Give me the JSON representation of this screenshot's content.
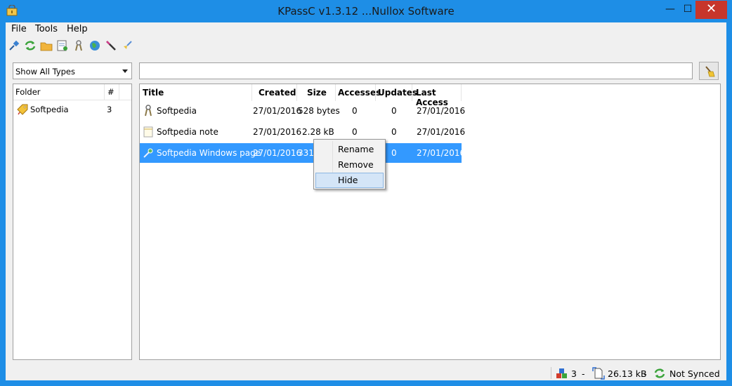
{
  "window": {
    "title": "KPassC v1.3.12 ...Nullox Software",
    "min_glyph": "—",
    "max_glyph": "☐",
    "close_glyph": "✕"
  },
  "menu": [
    "File",
    "Tools",
    "Help"
  ],
  "toolbar": {
    "icons": [
      "pin-icon",
      "sync-icon",
      "folder-icon",
      "note-icon",
      "key-icon",
      "globe-icon",
      "wand-icon",
      "broom-icon"
    ]
  },
  "filter": {
    "selected": "Show All Types"
  },
  "search": {
    "value": "",
    "placeholder": ""
  },
  "folders": {
    "columns": [
      "Folder",
      "#"
    ],
    "rows": [
      {
        "name": "Softpedia",
        "count": "3"
      }
    ]
  },
  "items": {
    "columns": [
      "Title",
      "Created",
      "Size",
      "Accesses",
      "Updates",
      "Last Access"
    ],
    "rows": [
      {
        "icon": "password-key-icon",
        "title": "Softpedia",
        "created": "27/01/2016",
        "size": "528 bytes",
        "accesses": "0",
        "updates": "0",
        "last_access": "27/01/2016",
        "selected": false
      },
      {
        "icon": "note-icon",
        "title": "Softpedia note",
        "created": "27/01/2016",
        "size": "2.28 kB",
        "accesses": "0",
        "updates": "0",
        "last_access": "27/01/2016",
        "selected": false
      },
      {
        "icon": "link-icon",
        "title": "Softpedia Windows page",
        "created": "27/01/2016",
        "size": "331",
        "accesses": "",
        "updates": "0",
        "last_access": "27/01/2016",
        "selected": true
      }
    ]
  },
  "context_menu": {
    "items": [
      {
        "label": "Rename",
        "hover": false
      },
      {
        "label": "Remove",
        "hover": false
      },
      {
        "label": "Hide",
        "hover": true
      }
    ]
  },
  "status": {
    "count": "3",
    "sep1": "-",
    "size": "26.13 kB",
    "sep2": "-",
    "sync": "Not Synced"
  },
  "colors": {
    "titlebar": "#1e8ee6",
    "selection": "#3399ff",
    "close": "#c7362b"
  }
}
